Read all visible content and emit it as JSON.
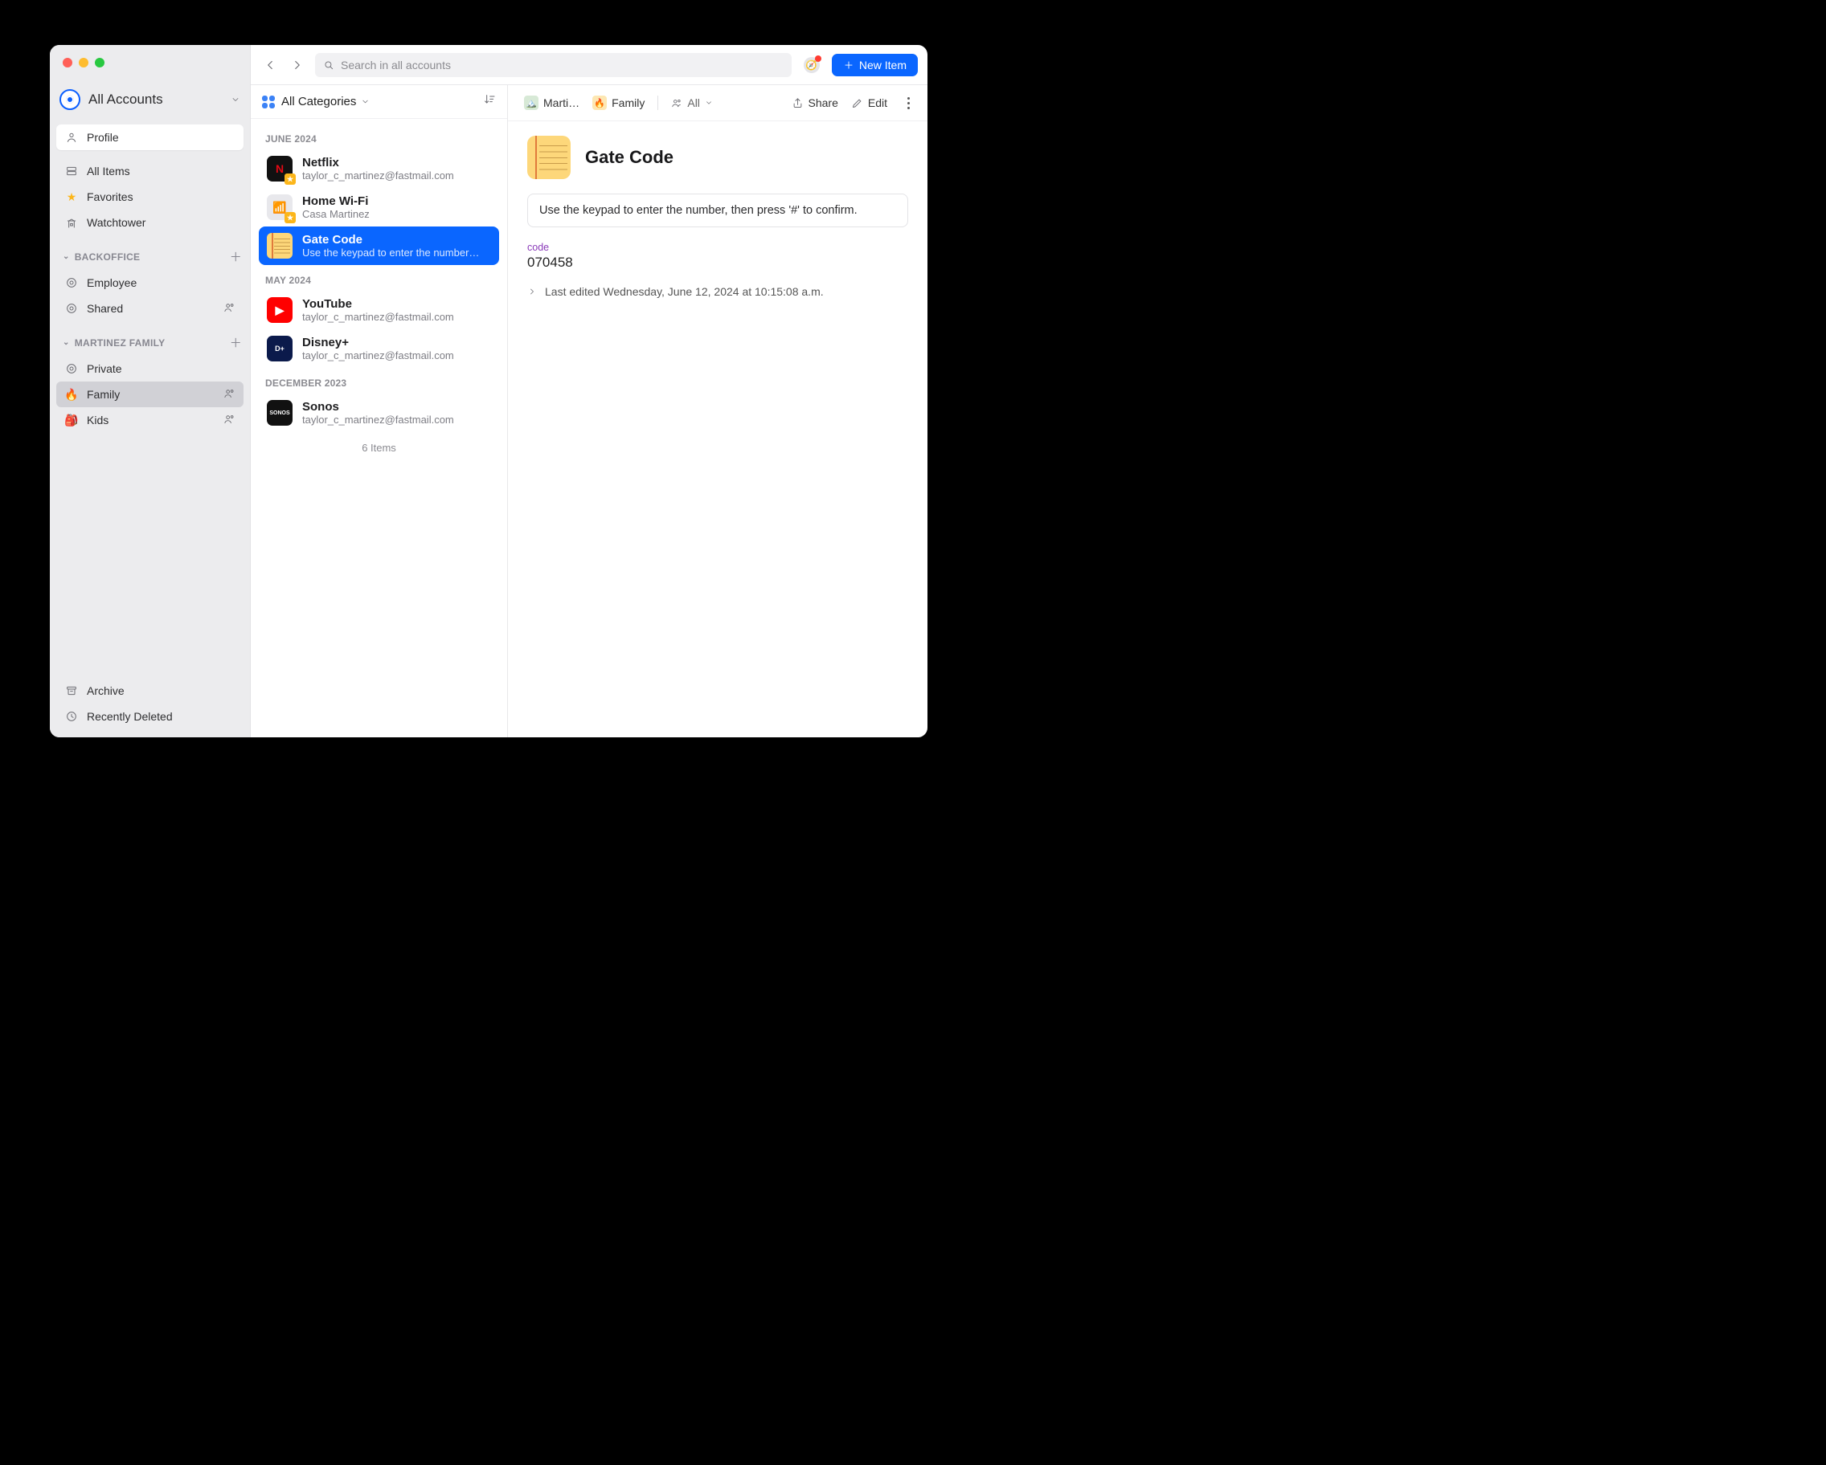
{
  "header": {
    "accounts_label": "All Accounts",
    "search_placeholder": "Search in all accounts",
    "new_item_label": "New Item"
  },
  "sidebar": {
    "profile_label": "Profile",
    "nav": {
      "all_items": "All Items",
      "favorites": "Favorites",
      "watchtower": "Watchtower"
    },
    "sections": [
      {
        "name": "BACKOFFICE",
        "vaults": [
          {
            "label": "Employee",
            "shared": false
          },
          {
            "label": "Shared",
            "shared": true
          }
        ]
      },
      {
        "name": "MARTINEZ FAMILY",
        "vaults": [
          {
            "label": "Private",
            "shared": false
          },
          {
            "label": "Family",
            "shared": true,
            "active": true
          },
          {
            "label": "Kids",
            "shared": true
          }
        ]
      }
    ],
    "footer": {
      "archive": "Archive",
      "recently_deleted": "Recently Deleted"
    }
  },
  "list": {
    "category_label": "All Categories",
    "groups": [
      {
        "heading": "JUNE 2024",
        "items": [
          {
            "title": "Netflix",
            "subtitle": "taylor_c_martinez@fastmail.com",
            "icon_color": "#111",
            "icon_text": "N",
            "icon_text_color": "#e50914",
            "starred": true
          },
          {
            "title": "Home Wi-Fi",
            "subtitle": "Casa Martinez",
            "icon_color": "#e8e8ec",
            "icon_text": "📶",
            "starred": true
          },
          {
            "title": "Gate Code",
            "subtitle": "Use the keypad to enter the number…",
            "icon": "note",
            "selected": true
          }
        ]
      },
      {
        "heading": "MAY 2024",
        "items": [
          {
            "title": "YouTube",
            "subtitle": "taylor_c_martinez@fastmail.com",
            "icon_color": "#ff0000",
            "icon_text": "▶"
          },
          {
            "title": "Disney+",
            "subtitle": "taylor_c_martinez@fastmail.com",
            "icon_color": "#0b1a4b",
            "icon_text": "D+",
            "icon_font_size": "9px"
          }
        ]
      },
      {
        "heading": "DECEMBER 2023",
        "items": [
          {
            "title": "Sonos",
            "subtitle": "taylor_c_martinez@fastmail.com",
            "icon_color": "#111",
            "icon_text": "SONOS",
            "icon_font_size": "7px"
          }
        ]
      }
    ],
    "footer_count": "6 Items"
  },
  "detail": {
    "breadcrumbs": {
      "account_short": "Marti…",
      "vault": "Family",
      "scope": "All"
    },
    "actions": {
      "share": "Share",
      "edit": "Edit"
    },
    "title": "Gate Code",
    "note": "Use the keypad to enter the number, then press '#' to confirm.",
    "fields": [
      {
        "label": "code",
        "value": "070458"
      }
    ],
    "last_edited": "Last edited Wednesday, June 12, 2024 at 10:15:08 a.m."
  }
}
